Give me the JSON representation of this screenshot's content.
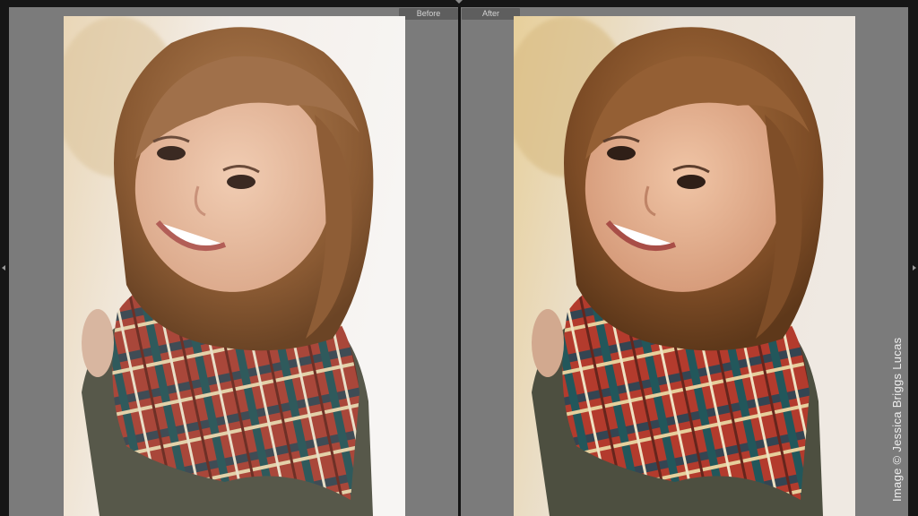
{
  "compare": {
    "before_label": "Before",
    "after_label": "After"
  },
  "watermark": {
    "text": "Image © Jessica Briggs Lucas"
  },
  "icons": {
    "left_panel_toggle": "triangle-left-icon",
    "right_panel_toggle": "triangle-right-icon",
    "top_panel_toggle": "triangle-down-icon"
  },
  "colors": {
    "pane_background": "#7b7b7b",
    "label_background": "#5e5e5e",
    "label_text": "#d4d4d4",
    "watermark_text": "#eeeeee"
  }
}
